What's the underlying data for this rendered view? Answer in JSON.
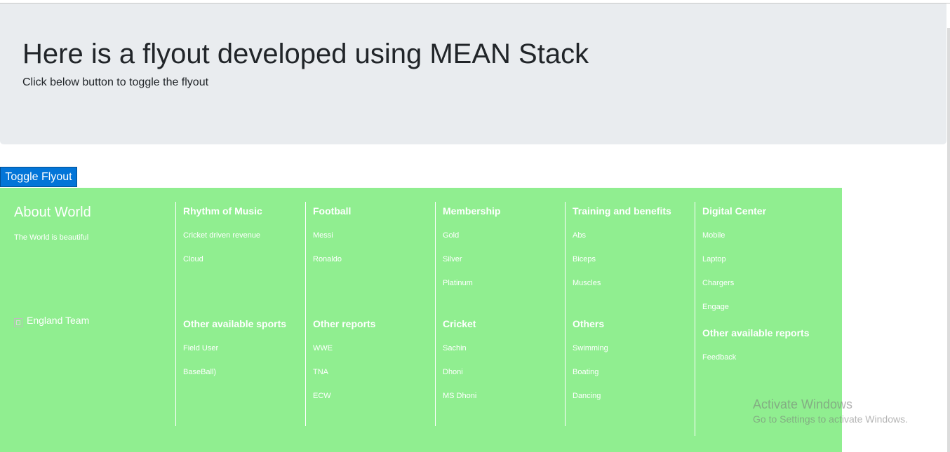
{
  "jumbotron": {
    "title": "Here is a flyout developed using MEAN Stack",
    "subtitle": "Click below button to toggle the flyout"
  },
  "toggle_button": {
    "label": "Toggle Flyout"
  },
  "flyout": {
    "about": {
      "title": "About World",
      "text": "The World is beautiful",
      "team_label": "England Team"
    },
    "columns": [
      {
        "sections": [
          {
            "title": "Rhythm of Music",
            "items": [
              "Cricket driven revenue",
              "Cloud"
            ]
          },
          {
            "title": "Other available sports",
            "items": [
              "Field User",
              "BaseBall)"
            ]
          }
        ]
      },
      {
        "sections": [
          {
            "title": "Football",
            "items": [
              "Messi",
              "Ronaldo"
            ]
          },
          {
            "title": "Other reports",
            "items": [
              "WWE",
              "TNA",
              "ECW"
            ]
          }
        ]
      },
      {
        "sections": [
          {
            "title": "Membership",
            "items": [
              "Gold",
              "Silver",
              "Platinum"
            ]
          },
          {
            "title": "Cricket",
            "items": [
              "Sachin",
              "Dhoni",
              "MS Dhoni"
            ]
          }
        ]
      },
      {
        "sections": [
          {
            "title": "Training and benefits",
            "items": [
              "Abs",
              "Biceps",
              "Muscles"
            ]
          },
          {
            "title": "Others",
            "items": [
              "Swimming",
              "Boating",
              "Dancing"
            ]
          }
        ]
      },
      {
        "sections": [
          {
            "title": "Digital Center",
            "items": [
              "Mobile",
              "Laptop",
              "Chargers",
              "Engage"
            ]
          },
          {
            "title": "Other available reports",
            "items": [
              "Feedback"
            ]
          }
        ]
      }
    ]
  },
  "watermark": {
    "title": "Activate Windows",
    "subtitle": "Go to Settings to activate Windows."
  },
  "colors": {
    "flyout_bg": "#90ee90",
    "button_bg": "#0275d8",
    "jumbotron_bg": "#e9ecef"
  }
}
